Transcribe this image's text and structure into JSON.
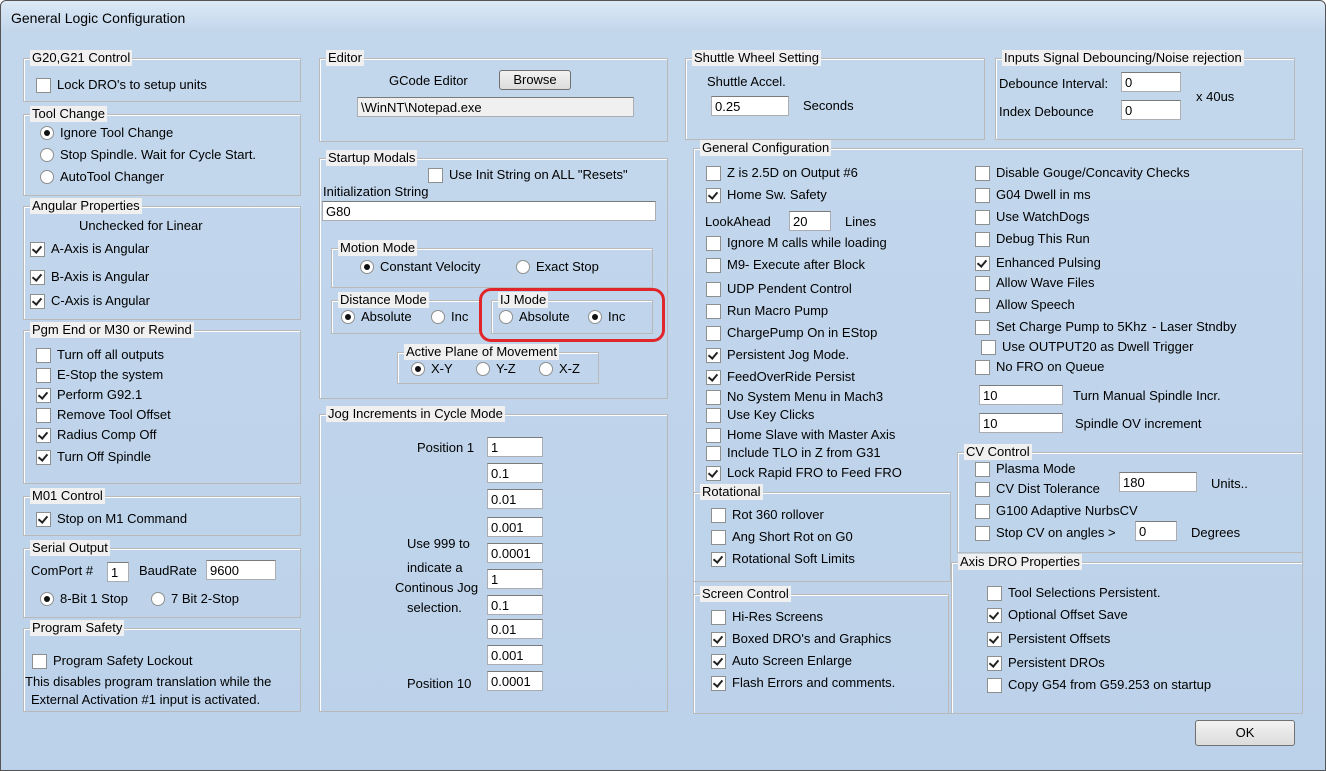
{
  "title": "General Logic Configuration",
  "g20": {
    "title": "G20,G21 Control",
    "lock": {
      "label": "Lock DRO's to setup units",
      "checked": false
    }
  },
  "tool": {
    "title": "Tool Change",
    "options": [
      {
        "label": "Ignore Tool Change",
        "selected": true
      },
      {
        "label": "Stop Spindle. Wait for Cycle Start.",
        "selected": false
      },
      {
        "label": "AutoTool Changer",
        "selected": false
      }
    ]
  },
  "angular": {
    "title": "Angular Properties",
    "note": "Unchecked for Linear",
    "items": [
      {
        "label": "A-Axis is Angular",
        "checked": true
      },
      {
        "label": "B-Axis is Angular",
        "checked": true
      },
      {
        "label": "C-Axis is Angular",
        "checked": true
      }
    ]
  },
  "pgmend": {
    "title": "Pgm End or M30 or Rewind",
    "items": [
      {
        "label": "Turn off all outputs",
        "checked": false
      },
      {
        "label": "E-Stop the system",
        "checked": false
      },
      {
        "label": "Perform G92.1",
        "checked": true
      },
      {
        "label": "Remove Tool Offset",
        "checked": false
      },
      {
        "label": "Radius Comp Off",
        "checked": true
      },
      {
        "label": "Turn Off Spindle",
        "checked": true
      }
    ]
  },
  "m01": {
    "title": "M01 Control",
    "stop": {
      "label": "Stop on M1 Command",
      "checked": true
    }
  },
  "serial": {
    "title": "Serial Output",
    "comport_label": "ComPort #",
    "comport": "1",
    "baud_label": "BaudRate",
    "baud": "9600",
    "options": [
      {
        "label": "8-Bit 1 Stop",
        "selected": true
      },
      {
        "label": "7 Bit 2-Stop",
        "selected": false
      }
    ]
  },
  "safety": {
    "title": "Program Safety",
    "lockout": {
      "label": "Program Safety Lockout",
      "checked": false
    },
    "note1": "This disables program translation while the",
    "note2": "External Activation #1 input is activated."
  },
  "editor": {
    "title": "Editor",
    "label": "GCode Editor",
    "browse": "Browse",
    "path": "\\WinNT\\Notepad.exe"
  },
  "startup": {
    "title": "Startup Modals",
    "use_init": {
      "label": "Use Init String on ALL  \"Resets\"",
      "checked": false
    },
    "init_label": "Initialization String",
    "init_value": "G80",
    "motion": {
      "title": "Motion Mode",
      "options": [
        {
          "label": "Constant Velocity",
          "selected": true
        },
        {
          "label": "Exact Stop",
          "selected": false
        }
      ]
    },
    "distance": {
      "title": "Distance Mode",
      "options": [
        {
          "label": "Absolute",
          "selected": true
        },
        {
          "label": "Inc",
          "selected": false
        }
      ]
    },
    "ij": {
      "title": "IJ Mode",
      "options": [
        {
          "label": "Absolute",
          "selected": false
        },
        {
          "label": "Inc",
          "selected": true
        }
      ]
    },
    "plane": {
      "title": "Active Plane of Movement",
      "options": [
        {
          "label": "X-Y",
          "selected": true
        },
        {
          "label": "Y-Z",
          "selected": false
        },
        {
          "label": "X-Z",
          "selected": false
        }
      ]
    }
  },
  "jog": {
    "title": "Jog Increments in Cycle Mode",
    "pos1": "Position 1",
    "pos10": "Position 10",
    "note": [
      "Use 999 to",
      "indicate a",
      "Continous Jog",
      "selection."
    ],
    "values": [
      "1",
      "0.1",
      "0.01",
      "0.001",
      "0.0001",
      "1",
      "0.1",
      "0.01",
      "0.001",
      "0.0001"
    ]
  },
  "shuttle": {
    "title": "Shuttle Wheel Setting",
    "accel_label": "Shuttle Accel.",
    "accel": "0.25",
    "unit": "Seconds"
  },
  "debounce": {
    "title": "Inputs Signal Debouncing/Noise rejection",
    "interval_label": "Debounce Interval:",
    "interval": "0",
    "index_label": "Index Debounce",
    "index": "0",
    "unit": "x 40us"
  },
  "general": {
    "title": "General Configuration",
    "lookahead_label": "LookAhead",
    "lookahead": "20",
    "lines": "Lines",
    "left": [
      {
        "label": "Z is 2.5D on Output #6",
        "checked": false
      },
      {
        "label": "Home Sw. Safety",
        "checked": true
      },
      {
        "label": "Ignore M calls while loading",
        "checked": false
      },
      {
        "label": "M9- Execute after Block",
        "checked": false
      },
      {
        "label": "UDP Pendent Control",
        "checked": false
      },
      {
        "label": "Run Macro Pump",
        "checked": false
      },
      {
        "label": "ChargePump On in EStop",
        "checked": false
      },
      {
        "label": "Persistent Jog Mode.",
        "checked": true
      },
      {
        "label": "FeedOverRide Persist",
        "checked": true
      },
      {
        "label": "No System Menu in Mach3",
        "checked": false
      },
      {
        "label": "Use Key Clicks",
        "checked": false
      },
      {
        "label": "Home Slave with Master Axis",
        "checked": false
      },
      {
        "label": "Include TLO in Z from G31",
        "checked": false
      },
      {
        "label": "Lock Rapid FRO to Feed FRO",
        "checked": true
      }
    ],
    "right": [
      {
        "label": "Disable Gouge/Concavity Checks",
        "checked": false
      },
      {
        "label": "G04 Dwell in ms",
        "checked": false
      },
      {
        "label": "Use WatchDogs",
        "checked": false
      },
      {
        "label": "Debug This Run",
        "checked": false
      },
      {
        "label": "Enhanced Pulsing",
        "checked": true
      },
      {
        "label": "Allow Wave Files",
        "checked": false
      },
      {
        "label": "Allow Speech",
        "checked": false
      },
      {
        "label": "Set Charge Pump to 5Khz",
        "checked": false
      },
      {
        "label": "Use OUTPUT20 as Dwell Trigger",
        "checked": false
      },
      {
        "label": "No FRO on Queue",
        "checked": false
      }
    ],
    "laser": "- Laser Stndby",
    "spindle_incr": "10",
    "spindle_incr_label": "Turn Manual Spindle Incr.",
    "spindle_ov": "10",
    "spindle_ov_label": "Spindle OV increment"
  },
  "rotational": {
    "title": "Rotational",
    "items": [
      {
        "label": "Rot 360 rollover",
        "checked": false
      },
      {
        "label": "Ang Short Rot on G0",
        "checked": false
      },
      {
        "label": "Rotational Soft Limits",
        "checked": true
      }
    ]
  },
  "cv": {
    "title": "CV Control",
    "items": [
      {
        "label": "Plasma Mode",
        "checked": false
      },
      {
        "label": "CV Dist Tolerance",
        "checked": false
      },
      {
        "label": "G100 Adaptive NurbsCV",
        "checked": false
      },
      {
        "label": "Stop CV on angles >",
        "checked": false
      }
    ],
    "tolerance": "180",
    "units": "Units..",
    "angle": "0",
    "degrees": "Degrees"
  },
  "screen": {
    "title": "Screen Control",
    "items": [
      {
        "label": "Hi-Res Screens",
        "checked": false
      },
      {
        "label": "Boxed DRO's and Graphics",
        "checked": true
      },
      {
        "label": "Auto Screen Enlarge",
        "checked": true
      },
      {
        "label": "Flash Errors and comments.",
        "checked": true
      }
    ]
  },
  "axisdro": {
    "title": "Axis DRO Properties",
    "items": [
      {
        "label": "Tool Selections Persistent.",
        "checked": false
      },
      {
        "label": "Optional Offset Save",
        "checked": true
      },
      {
        "label": "Persistent Offsets",
        "checked": true
      },
      {
        "label": "Persistent DROs",
        "checked": true
      },
      {
        "label": "Copy G54 from G59.253 on startup",
        "checked": false
      }
    ]
  },
  "ok": "OK"
}
